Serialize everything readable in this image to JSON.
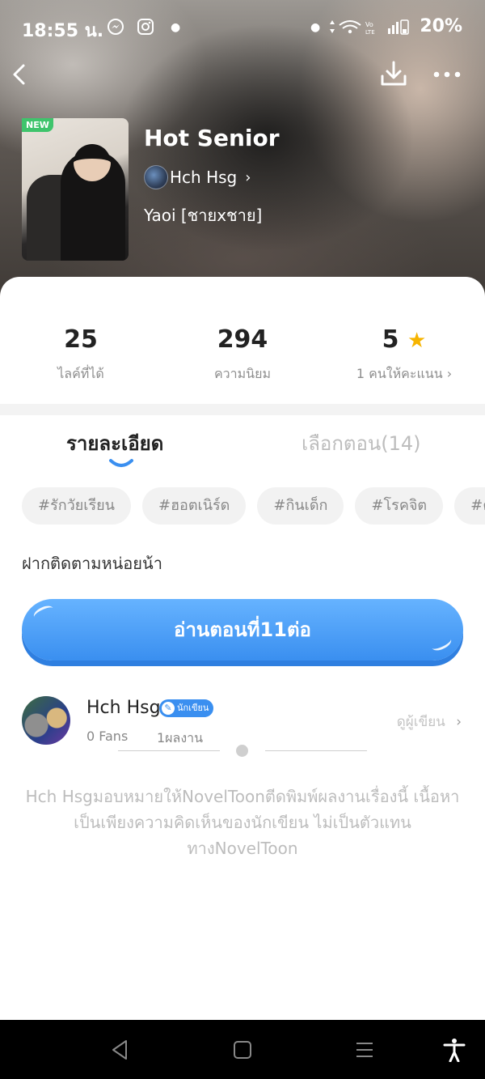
{
  "status_bar": {
    "time": "18:55 น.",
    "battery": "20%",
    "icons": [
      "messenger-icon",
      "instagram-icon",
      "dot-icon",
      "dot-icon",
      "data-arrows-icon",
      "wifi-icon",
      "volte-icon",
      "signal-icon",
      "battery-icon"
    ]
  },
  "header": {
    "badge": "NEW",
    "title": "Hot Senior",
    "author": "Hch Hsg",
    "genre": "Yaoi [ชายxชาย]"
  },
  "stats": [
    {
      "value": "25",
      "label": "ไลค์ที่ได้"
    },
    {
      "value": "294",
      "label": "ความนิยม"
    },
    {
      "value": "5",
      "label": "1 คนให้คะแนน"
    }
  ],
  "tabs": {
    "details": "รายละเอียด",
    "episodes": "เลือกตอน(14)"
  },
  "tags": [
    "#รักวัยเรียน",
    "#ฮอตเนิร์ด",
    "#กินเด็ก",
    "#โรคจิต",
    "#ค"
  ],
  "description": "ฝากติดตามหน่อยน้า",
  "read_button": "อ่านตอนที่11ต่อ",
  "author_card": {
    "name": "Hch Hsg",
    "badge": "นักเขียน",
    "fans": "0 Fans",
    "works": "1ผลงาน",
    "view_link": "ดูผู้เขียน"
  },
  "disclaimer": "Hch Hsgมอบหมายให้NovelToonตีดพิมพ์ผลงานเรื่องนี้ เนื้อหาเป็นเพียงความคิดเห็นของนักเขียน ไม่เป็นตัวแทนทางNovelToon",
  "colors": {
    "accent": "#3a8ff0",
    "new_badge": "#3fc46c",
    "star": "#f6b400"
  }
}
